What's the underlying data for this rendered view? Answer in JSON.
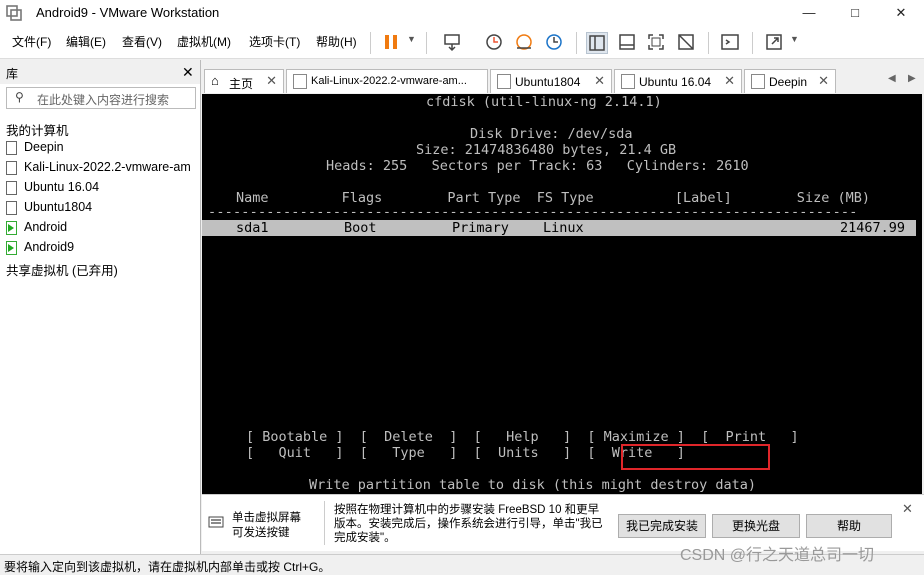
{
  "window": {
    "title": "Android9 - VMware Workstation"
  },
  "menus": [
    "文件(F)",
    "编辑(E)",
    "查看(V)",
    "虚拟机(M)",
    "选项卡(T)",
    "帮助(H)"
  ],
  "library": {
    "title": "库",
    "search_placeholder": "在此处键入内容进行搜索",
    "root": "我的计算机",
    "vms": [
      {
        "name": "Deepin",
        "running": false
      },
      {
        "name": "Kali-Linux-2022.2-vmware-am",
        "running": false
      },
      {
        "name": "Ubuntu 16.04",
        "running": false
      },
      {
        "name": "Ubuntu1804",
        "running": false
      },
      {
        "name": "Android",
        "running": true
      },
      {
        "name": "Android9",
        "running": true
      }
    ],
    "shared": "共享虚拟机 (已弃用)"
  },
  "tabs": [
    {
      "label": "主页"
    },
    {
      "label": "Kali-Linux-2022.2-vmware-am..."
    },
    {
      "label": "Ubuntu1804"
    },
    {
      "label": "Ubuntu 16.04"
    },
    {
      "label": "Deepin"
    }
  ],
  "console": {
    "header": "cfdisk (util-linux-ng 2.14.1)",
    "disk_drive": "Disk Drive: /dev/sda",
    "size_line": "Size: 21474836480 bytes, 21.4 GB",
    "geometry_line": "Heads: 255   Sectors per Track: 63   Cylinders: 2610",
    "table_header": "Name         Flags        Part Type  FS Type          [Label]        Size (MB)",
    "separator": "------------------------------------------------------------------------------",
    "row": {
      "name": "sda1",
      "flags": "Boot",
      "part_type": "Primary",
      "fs_type": "Linux",
      "size": "21467.99"
    },
    "menu_line1": "[ Bootable ]  [  Delete  ]  [   Help   ]  [ Maximize ]  [  Print   ]",
    "menu_line2": "[   Quit   ]  [   Type   ]  [  Units   ]  [  Write   ]",
    "status": "Write partition table to disk (this might destroy data)"
  },
  "hint": {
    "click_text": "单击虚拟屏幕\n可发送按键",
    "message": "按照在物理计算机中的步骤安装 FreeBSD 10 和更早版本。安装完成后，操作系统会进行引导，单击\"我已完成安装\"。",
    "buttons": [
      "我已完成安装",
      "更换光盘",
      "帮助"
    ]
  },
  "statusbar": {
    "text": "要将输入定向到该虚拟机，请在虚拟机内部单击或按 Ctrl+G。",
    "watermark": "CSDN @行之天道总司一切"
  }
}
